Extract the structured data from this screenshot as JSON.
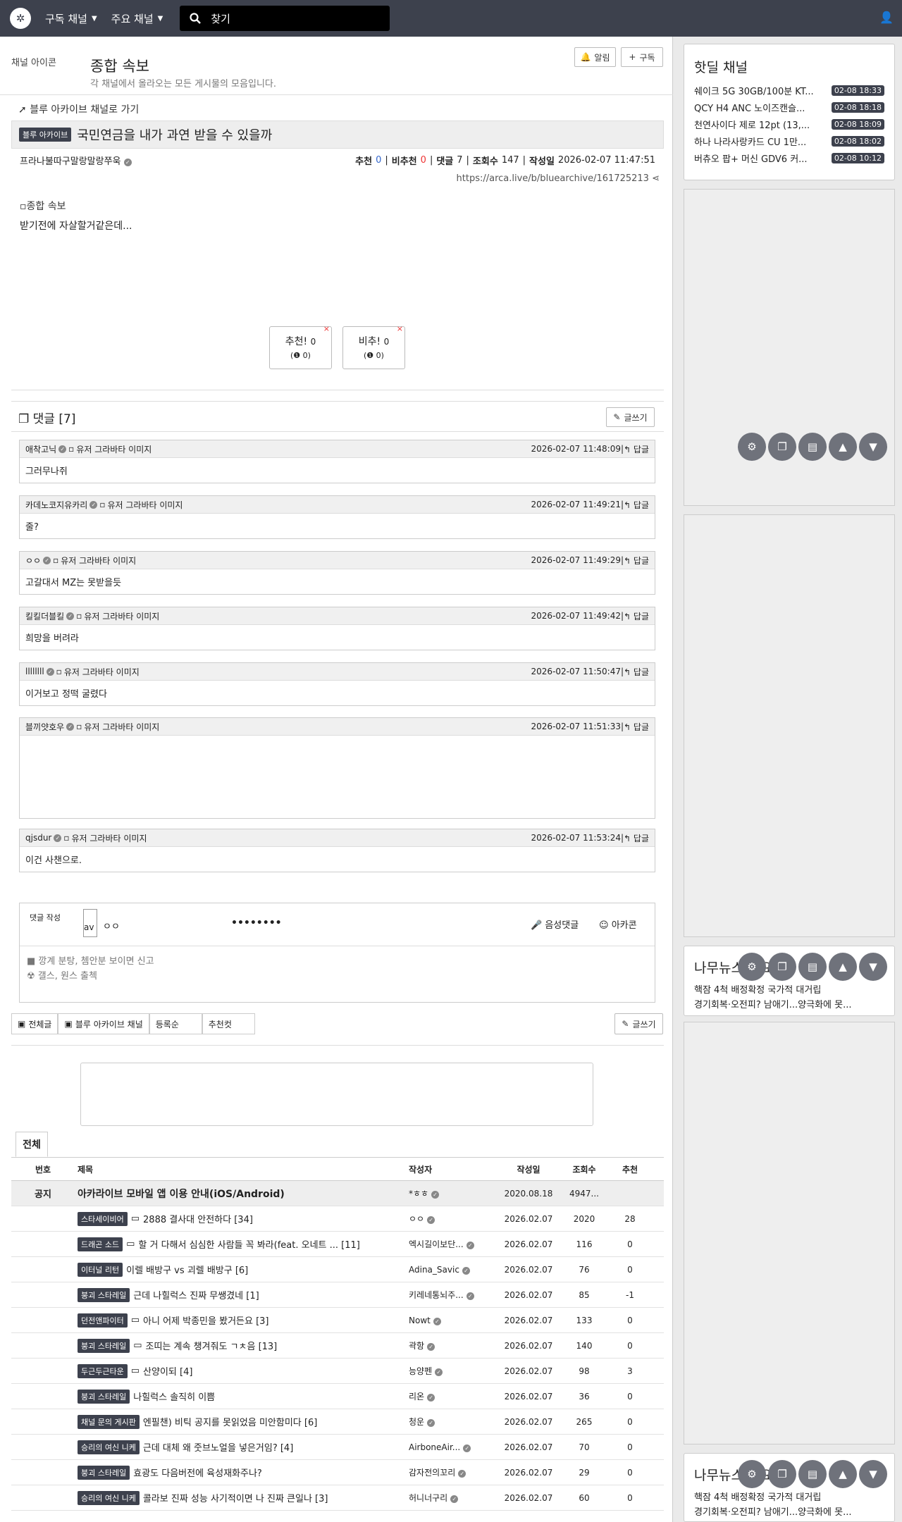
{
  "nav": {
    "subscribed": "구독 채널",
    "major": "주요 채널",
    "search_placeholder": "찾기"
  },
  "channel": {
    "icon_alt": "채널 아이콘",
    "title": "종합 속보",
    "desc": "각 채널에서 올라오는 모든 게시물의 모음입니다.",
    "alarm": "알림",
    "subscribe": "구독"
  },
  "post": {
    "back": "블루 아카이브 채널로 가기",
    "badge": "블루 아카이브",
    "title": "국민연금을 내가 과연 받을 수 있을까",
    "author": "프라나불따구말랑말랑쭈욱",
    "rec_label": "추천",
    "rec": "0",
    "unrec_label": "비추천",
    "unrec": "0",
    "cmt_label": "댓글",
    "cmt": "7",
    "views_label": "조회수",
    "views": "147",
    "date_label": "작성일",
    "date": "2026-02-07 11:47:51",
    "url": "https://arca.live/b/bluearchive/161725213",
    "img_alt": "종합 속보",
    "body": "받기전에 자살할거같은데...",
    "vote_up": "추천!",
    "vote_up_n": "0",
    "vote_up_sub": "(❶ 0)",
    "vote_down": "비추!",
    "vote_down_n": "0",
    "vote_down_sub": "(❶ 0)"
  },
  "comments_header": "댓글 [7]",
  "write_label": "글쓰기",
  "reply": "답글",
  "avatar_alt": "유저 그라바타 이미지",
  "comments": [
    {
      "name": "애착고닉",
      "date": "2026-02-07 11:48:09",
      "text": "그러무나쥐"
    },
    {
      "name": "카데노코지유카리",
      "date": "2026-02-07 11:49:21",
      "text": "줄?"
    },
    {
      "name": "ㅇㅇ",
      "date": "2026-02-07 11:49:29",
      "text": "고갈대서 MZ는 못받을듯"
    },
    {
      "name": "킬킬더블킬",
      "date": "2026-02-07 11:49:42",
      "text": "희망을 버려라"
    },
    {
      "name": "llllllll",
      "date": "2026-02-07 11:50:47",
      "text": "이거보고 정떡 굴렸다"
    },
    {
      "name": "블끼얏호우",
      "date": "2026-02-07 11:51:33",
      "text": ""
    },
    {
      "name": "qjsdur",
      "date": "2026-02-07 11:53:24",
      "text": "이건 사챈으로."
    }
  ],
  "form": {
    "label": "댓글 작성",
    "avatar": "av",
    "name": "ㅇㅇ",
    "password": "••••••••",
    "voice": "음성댓글",
    "arcacon": "아카콘",
    "rule1": "깡계 분탕, 쳄안분 보이면 신고",
    "rule2": "갤스, 원스 출첵"
  },
  "tabs": {
    "all": "전체글",
    "channel": "블루 아카이브 채널",
    "sort": "등록순",
    "best": "추천컷",
    "write": "글쓰기",
    "list_tab": "전체"
  },
  "list": {
    "headers": {
      "no": "번호",
      "title": "제목",
      "author": "작성자",
      "date": "작성일",
      "views": "조회수",
      "rate": "추천"
    },
    "notice": {
      "no": "공지",
      "title": "아카라이브 모바일 앱 이용 안내(iOS/Android)",
      "author": "*ㅎㅎ",
      "date": "2020.08.18",
      "views": "4947...",
      "rate": ""
    },
    "rows": [
      {
        "badge": "스타세이비어",
        "title": "2888 결사대 안전하다 [34]",
        "author": "ㅇㅇ",
        "date": "2026.02.07",
        "views": "2020",
        "rate": "28"
      },
      {
        "badge": "드래곤 소드",
        "title": "할 거 다해서 심심한 사람들 꼭 봐라(feat. 오네트 ... [11]",
        "author": "엑시길이보단...",
        "date": "2026.02.07",
        "views": "116",
        "rate": "0"
      },
      {
        "badge": "이터널 리턴",
        "title": "이렐 배방구 vs 괴렐 배방구 [6]",
        "author": "Adina_Savic",
        "date": "2026.02.07",
        "views": "76",
        "rate": "0"
      },
      {
        "badge": "붕괴 스타레일",
        "title": "근데 나힐럭스 진짜 무쌩겼네 [1]",
        "author": "키레네통뇌주...",
        "date": "2026.02.07",
        "views": "85",
        "rate": "-1"
      },
      {
        "badge": "던전앤파이터",
        "title": "아니 어제 박종민을 봤거든요 [3]",
        "author": "Nowt",
        "date": "2026.02.07",
        "views": "133",
        "rate": "0"
      },
      {
        "badge": "붕괴 스타레일",
        "title": "조띠는 계속 챙겨줘도 ㄱㅊ음 [13]",
        "author": "곽항",
        "date": "2026.02.07",
        "views": "140",
        "rate": "0"
      },
      {
        "badge": "두근두근타운",
        "title": "산양이되 [4]",
        "author": "능양펜",
        "date": "2026.02.07",
        "views": "98",
        "rate": "3"
      },
      {
        "badge": "붕괴 스타레일",
        "title": "나힐럭스 솔직히 이쁨",
        "author": "리온",
        "date": "2026.02.07",
        "views": "36",
        "rate": "0"
      },
      {
        "badge": "채널 문의 게시판",
        "title": "엔필챈) 비틱 공지를 못읽었음 미안함미다 [6]",
        "author": "청운",
        "date": "2026.02.07",
        "views": "265",
        "rate": "0"
      },
      {
        "badge": "승리의 여신 니케",
        "title": "근데 대체 왜 줏브노얼을 넣은거임? [4]",
        "author": "AirboneAir...",
        "date": "2026.02.07",
        "views": "70",
        "rate": "0"
      },
      {
        "badge": "붕괴 스타레일",
        "title": "효광도 다음버전에 육성재화주나?",
        "author": "감자전의꼬리",
        "date": "2026.02.07",
        "views": "29",
        "rate": "0"
      },
      {
        "badge": "승리의 여신 니케",
        "title": "콜라보 진짜 성능 사기적이면 나 진짜 큰일나 [3]",
        "author": "허니너구리",
        "date": "2026.02.07",
        "views": "60",
        "rate": "0"
      }
    ]
  },
  "sidebar": {
    "hot_title": "핫딜 채널",
    "hot": [
      {
        "text": "쉐이크 5G 30GB/100분 KT...",
        "time": "02-08 18:33"
      },
      {
        "text": "QCY H4 ANC 노이즈캔슬...",
        "time": "02-08 18:18"
      },
      {
        "text": "천연사이다 제로 12pt (13,...",
        "time": "02-08 18:09"
      },
      {
        "text": "하나 나라사랑카드 CU 1만...",
        "time": "02-08 18:02"
      },
      {
        "text": "버츄오 팝+ 머신 GDV6 커...",
        "time": "02-08 10:12"
      }
    ],
    "news_title": "나무뉴스 주요",
    "news1": "핵잠 4척 배정확정 국가적 대거립",
    "news2": "경기회복·오전피? 남애기...양극화에 못..."
  }
}
